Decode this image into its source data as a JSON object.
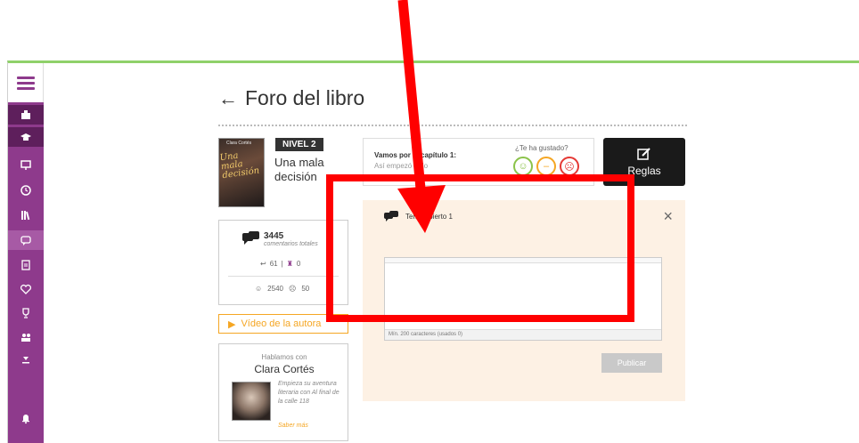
{
  "sidebar": {
    "items": [
      {
        "icon": "school-icon"
      },
      {
        "icon": "graduation-cap-icon"
      },
      {
        "icon": "presentation-icon"
      },
      {
        "icon": "clock-icon"
      },
      {
        "icon": "library-icon"
      },
      {
        "icon": "chat-icon"
      },
      {
        "icon": "document-icon"
      },
      {
        "icon": "heart-icon"
      },
      {
        "icon": "trophy-icon"
      },
      {
        "icon": "users-icon"
      },
      {
        "icon": "download-icon"
      },
      {
        "icon": "bell-icon"
      }
    ],
    "accent": "#8e3a8c"
  },
  "page": {
    "title": "Foro del libro",
    "back_glyph": "←"
  },
  "book": {
    "cover_title": "Una mala decisión",
    "cover_author": "Clara Cortés",
    "level": "NIVEL 2",
    "title": "Una mala decisión"
  },
  "stats": {
    "count": "3445",
    "count_label": "comentarios totales",
    "replies": "61",
    "divider": "|",
    "badges": "0",
    "likes": "2540",
    "dislikes": "50"
  },
  "video": {
    "label": "Vídeo de la autora"
  },
  "author": {
    "intro": "Hablamos con",
    "name": "Clara Cortés",
    "description": "Empieza su aventura literaria con Al final de la calle 118",
    "more": "Saber más"
  },
  "chapter": {
    "title": "Vamos por el capítulo 1:",
    "subtitle": "Así empezó todo",
    "question": "¿Te ha gustado?"
  },
  "rules": {
    "label": "Reglas"
  },
  "panel": {
    "topic": "Tema abierto 1",
    "close": "×",
    "textarea_value": "",
    "counter": "Mín. 200 caracteres (usados 0)",
    "publish": "Publicar"
  },
  "annotation": {
    "color": "#ff0000"
  }
}
